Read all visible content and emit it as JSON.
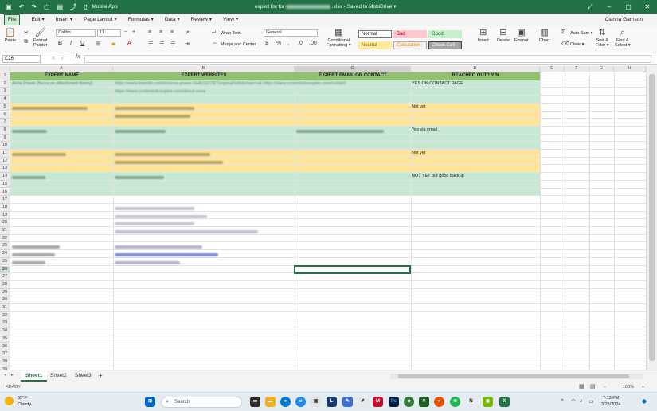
{
  "titlebar": {
    "mobile_app": "Mobile App",
    "doc_prefix": "expert list for",
    "doc_suffix": ".xlsx - Saved to MobiDrive ▾"
  },
  "menubar": {
    "items": [
      "File",
      "Edit ▾",
      "Insert ▾",
      "Page Layout ▾",
      "Formulas ▾",
      "Data ▾",
      "Review ▾",
      "View ▾"
    ],
    "user": "Cianna Garrison"
  },
  "ribbon": {
    "paste": "Paste",
    "format_painter": "Format\nPainter",
    "font_name": "Calibri",
    "font_size": "11",
    "wrap_text": "Wrap Text",
    "merge_center": "Merge and Center",
    "number_format": "General",
    "conditional_formatting": "Conditional\nFormatting ▾",
    "styles": {
      "normal": "Normal",
      "bad": "Bad",
      "good": "Good",
      "neutral": "Neutral",
      "calculation": "Calculation",
      "check_cell": "Check Cell"
    },
    "insert": "Insert",
    "delete": "Delete",
    "format": "Format",
    "chart": "Chart",
    "auto_sum": "Auto Sum ▾",
    "clear": "Clear ▾",
    "sort_filter": "Sort &\nFilter ▾",
    "find_select": "Find &\nSelect ▾"
  },
  "formula_bar": {
    "name_box": "C26",
    "fx": "fx",
    "formula": ""
  },
  "grid": {
    "columns": [
      "A",
      "B",
      "C",
      "D",
      "E",
      "F",
      "G",
      "H"
    ],
    "selected_column": "C",
    "selected_row": 26,
    "headers": {
      "a": "EXPERT NAME",
      "b": "EXPERT WEBSITES",
      "c": "EXPERT EMAIL OR CONTACT",
      "d": "REACHED OUT? Y/N"
    },
    "rows": {
      "r2_a": "Anna Power (focus on attachment theory)",
      "r2_b": "https://www.linkedin.com/in/anna-power-0a4b1b278/?originalSubdomain=uk https://www.contentedcouples.com/contact",
      "r3_b": "https://www.contentedcouples.com/about-anna",
      "r2_d": "YES ON CONTACT PAGE",
      "r5_d": "Not yet",
      "r8_d": "Yes via email",
      "r11_d": "Not yet",
      "r14_d": "NOT YET but good backup"
    },
    "row_numbers": [
      "1",
      "2",
      "3",
      "4",
      "5",
      "6",
      "7",
      "8",
      "9",
      "10",
      "11",
      "12",
      "13",
      "14",
      "15",
      "16",
      "17",
      "18",
      "19",
      "20",
      "21",
      "22",
      "23",
      "24",
      "25",
      "26",
      "27",
      "28",
      "29",
      "30",
      "31",
      "32",
      "33",
      "34",
      "35",
      "36",
      "37",
      "38",
      "39"
    ]
  },
  "sheets": {
    "tabs": [
      "Sheet1",
      "Sheet2",
      "Sheet3"
    ],
    "active": "Sheet1",
    "add": "+"
  },
  "status": {
    "ready": "READY",
    "zoom": "100%"
  },
  "taskbar": {
    "temp": "55°F",
    "weather": "Cloudy",
    "search": "Search",
    "time": "7:13 PM",
    "date": "3/25/2024"
  },
  "colors": {
    "accent": "#217346",
    "header_green": "#92c06e",
    "band_green": "#c7e9d3",
    "band_yellow": "#ffe59a"
  }
}
